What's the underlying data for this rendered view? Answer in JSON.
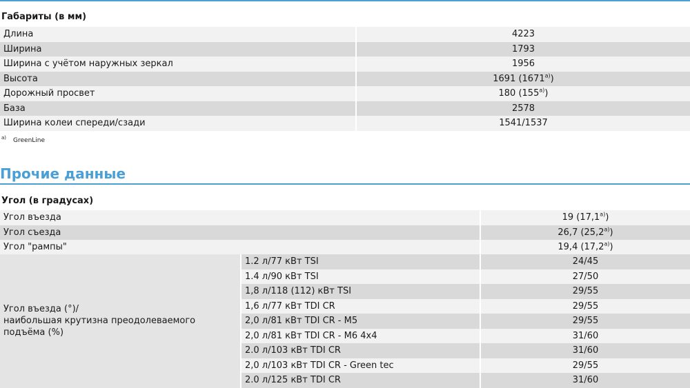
{
  "dimensions": {
    "heading": "Габариты (в мм)",
    "rows": [
      {
        "label": "Длина",
        "value": "4223",
        "sup": ""
      },
      {
        "label": "Ширина",
        "value": "1793",
        "sup": ""
      },
      {
        "label": "Ширина с учётом наружных зеркал",
        "value": "1956",
        "sup": ""
      },
      {
        "label": "Высота",
        "value": "1691 (1671",
        "sup": "a)",
        "tail": ")"
      },
      {
        "label": "Дорожный просвет",
        "value": "180 (155",
        "sup": "a)",
        "tail": ")"
      },
      {
        "label": "База",
        "value": "2578",
        "sup": ""
      },
      {
        "label": "Ширина колеи спереди/сзади",
        "value": "1541/1537",
        "sup": ""
      }
    ]
  },
  "footnote": {
    "mark": "a)",
    "text": "GreenLine"
  },
  "other": {
    "title": "Прочие данные",
    "angle_heading": "Угол (в градусах)",
    "angles": [
      {
        "label": "Угол въезда",
        "value": "19 (17,1",
        "sup": "a)",
        "tail": ")"
      },
      {
        "label": "Угол съезда",
        "value": "26,7 (25,2",
        "sup": "a)",
        "tail": ")"
      },
      {
        "label": "Угол \"рампы\"",
        "value": "19,4 (17,2",
        "sup": "a)",
        "tail": ")"
      }
    ],
    "group_label_1": "Угол въезда (°)/",
    "group_label_2": "наибольшая крутизна преодолеваемого подъёма (%)",
    "engines": [
      {
        "engine": "1.2 л/77 кВт TSI",
        "value": "24/45"
      },
      {
        "engine": "1.4 л/90 кВт TSI",
        "value": "27/50"
      },
      {
        "engine": "1,8 л/118 (112) кВт TSI",
        "value": "29/55"
      },
      {
        "engine": "1,6 л/77 кВт TDI CR",
        "value": "29/55"
      },
      {
        "engine": "2,0 л/81 кВт TDI CR - М5",
        "value": "29/55"
      },
      {
        "engine": "2,0 л/81 кВт TDI CR - М6 4x4",
        "value": "31/60"
      },
      {
        "engine": "2.0 л/103 кВт TDI CR",
        "value": "31/60"
      },
      {
        "engine": "2,0 л/103 кВт TDI CR - Green tec",
        "value": "29/55"
      },
      {
        "engine": "2.0 л/125 кВт TDI CR",
        "value": "31/60"
      }
    ]
  }
}
